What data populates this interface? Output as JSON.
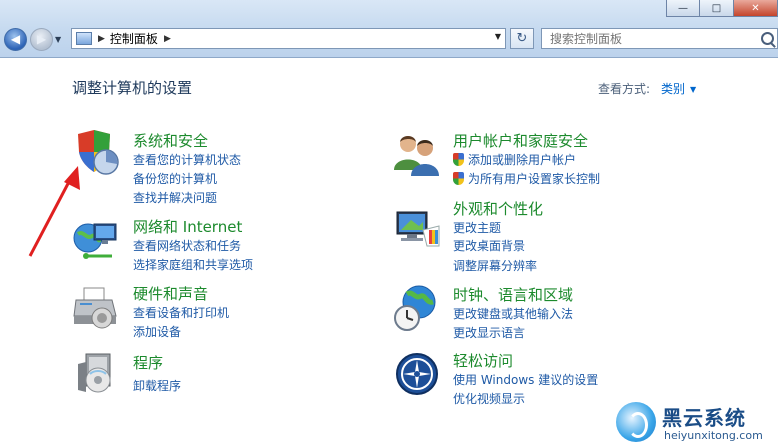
{
  "window": {
    "minimize_label": "—",
    "maximize_label": "□",
    "close_label": "✕"
  },
  "nav": {
    "back_label": "◀",
    "forward_label": "▶"
  },
  "address": {
    "segment": "控制面板",
    "separator": "▶"
  },
  "search": {
    "placeholder": "搜索控制面板"
  },
  "page": {
    "title": "调整计算机的设置",
    "view_by_label": "查看方式:",
    "view_by_value": "类别"
  },
  "categories": [
    {
      "title": "系统和安全",
      "icon": "shield-pie-icon",
      "links": [
        "查看您的计算机状态",
        "备份您的计算机",
        "查找并解决问题"
      ]
    },
    {
      "title": "网络和 Internet",
      "icon": "network-globe-icon",
      "links": [
        "查看网络状态和任务",
        "选择家庭组和共享选项"
      ]
    },
    {
      "title": "硬件和声音",
      "icon": "printer-icon",
      "links": [
        "查看设备和打印机",
        "添加设备"
      ]
    },
    {
      "title": "程序",
      "icon": "programs-box-icon",
      "links": [
        "卸载程序"
      ]
    },
    {
      "title": "用户帐户和家庭安全",
      "icon": "users-icon",
      "links": [
        "添加或删除用户帐户",
        "为所有用户设置家长控制"
      ]
    },
    {
      "title": "外观和个性化",
      "icon": "monitor-palette-icon",
      "links": [
        "更改主题",
        "更改桌面背景",
        "调整屏幕分辨率"
      ]
    },
    {
      "title": "时钟、语言和区域",
      "icon": "clock-globe-icon",
      "links": [
        "更改键盘或其他输入法",
        "更改显示语言"
      ]
    },
    {
      "title": "轻松访问",
      "icon": "ease-of-access-icon",
      "links": [
        "使用 Windows 建议的设置",
        "优化视频显示"
      ]
    }
  ],
  "watermark": {
    "brand": "黑云系统",
    "url": "heiyunxitong.com"
  },
  "colors": {
    "category_title": "#1c8a2d",
    "link": "#1f5aa6",
    "annotation_arrow": "#e02020"
  }
}
